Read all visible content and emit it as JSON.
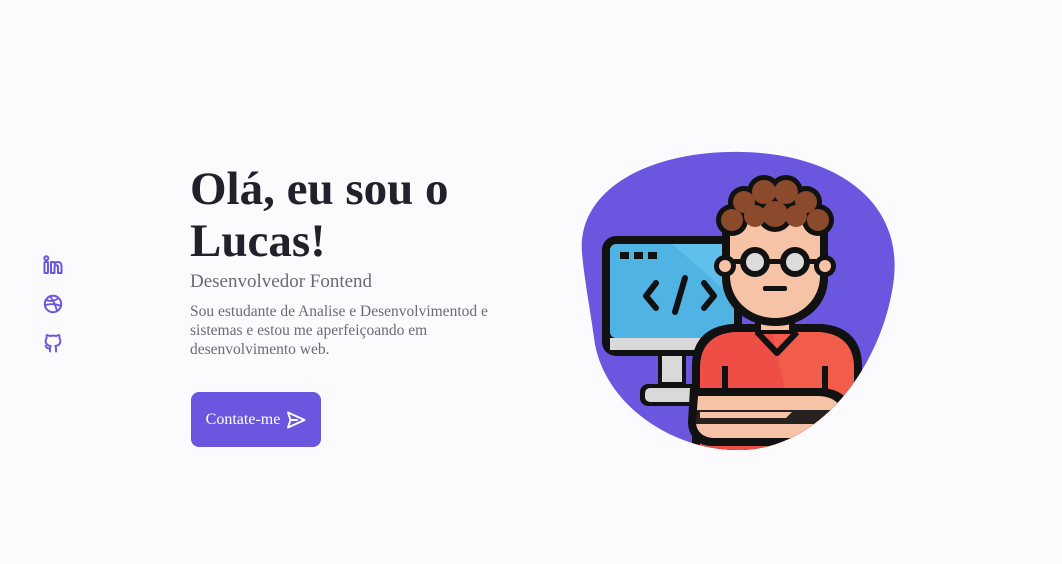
{
  "social": {
    "items": [
      {
        "icon": "linkedin-icon",
        "label": "LinkedIn"
      },
      {
        "icon": "dribbble-icon",
        "label": "Dribbble"
      },
      {
        "icon": "github-icon",
        "label": "GitHub"
      }
    ]
  },
  "hero": {
    "title": "Olá, eu sou o Lucas!",
    "subtitle": "Desenvolvedor Fontend",
    "description": "Sou estudante de Analise e Desenvolvimentod e sistemas e estou me aperfeiçoando em desenvolvimento web.",
    "button_label": "Contate-me",
    "button_icon": "send-icon"
  },
  "illustration": {
    "icon": "developer-avatar-illustration",
    "code_symbol": "</>"
  },
  "colors": {
    "accent": "#6b56e0",
    "background": "#fbfbfe",
    "title": "#22212b",
    "text": "#6b6a76"
  }
}
